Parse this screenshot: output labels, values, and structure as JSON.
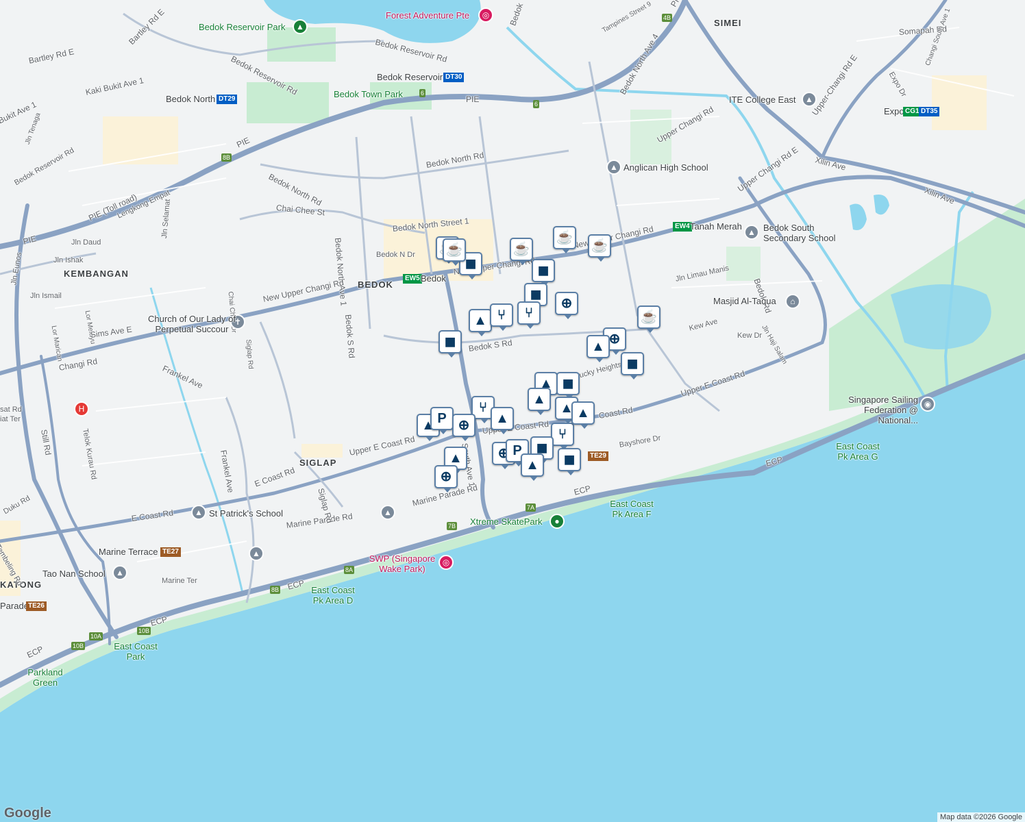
{
  "map": {
    "attribution": "Map data ©2026 Google",
    "logo": "Google",
    "colors": {
      "sea": "#8ed6ee",
      "park": "#c8ecd2",
      "road_major": "#8aa2c3",
      "land": "#f1f3f4",
      "pin_border": "#5b7fa6",
      "pin_icon": "#0b3b63"
    }
  },
  "areas": {
    "kembangan": "KEMBANGAN",
    "bedok": "BEDOK",
    "siglap": "SIGLAP",
    "simei": "SIMEI",
    "katong": "KATONG"
  },
  "roads": {
    "bartley": "Bartley Rd E",
    "bartley2": "Bartley Rd E",
    "kaki": "Kaki Bukit Ave 1",
    "bukit_ave": "Bukit Ave 1",
    "jln_tenaga": "Jln Tenaga",
    "bedok_res_rd_w": "Bedok Reservoir Rd",
    "bedok_res_rd": "Bedok Reservoir Rd",
    "bedok_res_rd2": "Bedok Reservoir Rd",
    "bedok_north_rd": "Bedok North Rd",
    "bedok_north_rd2": "Bedok North Rd",
    "chai_chee": "Chai Chee St",
    "lengkong": "Lengkong Empat",
    "jln_selamat": "Jln Selamat",
    "jln_daud": "Jln Daud",
    "jln_ishak": "Jln Ishak",
    "jln_eunos": "Jln Eunos",
    "jln_ismail": "Jln Ismail",
    "lor_marican": "Lor Marican",
    "lor_melayu": "Lor Melayu",
    "chai_chee_dr": "Chai Chee Dr",
    "siglap_rd": "Siglap Rd",
    "bedok_n_st1": "Bedok North Street 1",
    "bedok_n_dr": "Bedok N Dr",
    "bedok_n_ave1": "Bedok North Ave 1",
    "bedok_s_rd_v": "Bedok S Rd",
    "bedok_s_rd": "Bedok S Rd",
    "new_upper_changi_w": "New Upper Changi Rd",
    "new_upper_changi_e": "New Upper Changi Rd",
    "new_upper_changi_c": "New Upper Changi Rd",
    "sims_ave": "Sims Ave E",
    "changi_rd": "Changi Rd",
    "frankel": "Frankel Ave",
    "frankel2": "Frankel Ave",
    "upper_e_coast_w": "Upper E Coast Rd",
    "upper_e_coast_c": "Upper E Coast Rd",
    "upper_e_coast_e": "Upper E Coast Rd",
    "upper_e_coast_e2": "Coast Rd",
    "e_coast_rd": "E Coast Rd",
    "e_coast_rd2": "E Coast Rd",
    "marine_parade": "Marine Parade Rd",
    "marine_parade2": "Marine Parade Rd",
    "marine_terrace_rd": "Marine Ter",
    "siglap_rd2": "Siglap Rd",
    "bedok_south_ave1": "South Ave 1",
    "bayshore": "Bayshore Dr",
    "stills": "Still Rd",
    "telok": "Telok Kurau Rd",
    "duku": "Duku Rd",
    "tembeling": "Tembeling Rd",
    "bedok_rd": "Bedok Rd",
    "upper_changi_rd": "Upper Changi Rd",
    "upper_changi_e": "Upper Changi Rd E",
    "upper_changi_e2": "Upper-Changi Rd E",
    "xilin": "Xilin Ave",
    "xilin2": "Xilin Ave",
    "bedok_north_ave4": "Bedok North Ave 4",
    "tampines_st": "Tampines Street 9",
    "somapah": "Somapah Rd",
    "expo_dr": "Expo Dr",
    "changi_south_ave1": "Changi South Ave 1",
    "jln_limau": "Jln Limau Manis",
    "kew_ave": "Kew Ave",
    "kew_dr": "Kew Dr",
    "jln_haji": "Jln Haji Salam",
    "lucky": "Lucky Heights",
    "pie1": "PIE",
    "pie2": "PIE",
    "pie3": "PIE",
    "pie4": "PIE",
    "pie_toll": "PIE (Toll road)",
    "ecp1": "ECP",
    "ecp2": "ECP",
    "ecp3": "ECP",
    "ecp4": "ECP",
    "ecp5": "ECP",
    "jln_sat": "sat Rd",
    "jln_iat": "iat Ter",
    "bedok_upper": "Bedok"
  },
  "places": {
    "forest_adventure": "Forest Adventure Pte",
    "bedok_reservoir_park": "Bedok Reservoir Park",
    "bedok_town_park": "Bedok Town Park",
    "ite": "ITE College East",
    "anglican": "Anglican High School",
    "bedok_south_sec": "Bedok South Secondary School",
    "masjid": "Masjid Al-Taqua",
    "church": "Church of Our Lady of Perpetual Succour",
    "st_patricks": "St Patrick's School",
    "tao_nan": "Tao Nan School",
    "sailing": "Singapore Sailing Federation @ National...",
    "xtreme": "Xtreme SkatePark",
    "swp": "SWP (Singapore Wake Park)",
    "ecp_f": "East Coast Pk Area F",
    "ecp_g": "East Coast Pk Area G",
    "ecp_d": "East Coast Pk Area D",
    "east_coast_park": "East Coast Park",
    "parkland": "Parkland Green"
  },
  "stations": {
    "bedok_reservoir": {
      "name": "Bedok Reservoir",
      "code": "DT30"
    },
    "bedok_north": {
      "name": "Bedok North",
      "code": "DT29"
    },
    "bedok": {
      "name": "Bedok",
      "code": "EW5"
    },
    "tanah_merah": {
      "name": "Tanah Merah",
      "code": "EW4"
    },
    "expo": {
      "name": "Expo",
      "code1": "CG1",
      "code2": "DT35"
    },
    "marine_terrace": {
      "name": "Marine Terrace",
      "code": "TE27"
    },
    "marine_parade": {
      "name": "Parade",
      "code": "TE26"
    },
    "bayshore": {
      "name": "",
      "code": "TE29"
    }
  },
  "exits": [
    "8B",
    "6",
    "6",
    "4B",
    "7A",
    "7B",
    "8A",
    "8B",
    "10A",
    "10B",
    "10B"
  ],
  "pin_types": {
    "cafe": "coffee-cup-icon",
    "shop": "shopping-bag-icon",
    "school": "graduation-cap-icon",
    "food": "fork-knife-icon",
    "cart": "shopping-cart-icon",
    "parking": "parking-icon"
  },
  "pins": [
    {
      "type": "cafe"
    },
    {
      "type": "cafe"
    },
    {
      "type": "shop"
    },
    {
      "type": "cafe"
    },
    {
      "type": "cafe"
    },
    {
      "type": "cafe"
    },
    {
      "type": "shop"
    },
    {
      "type": "shop"
    },
    {
      "type": "cart"
    },
    {
      "type": "school"
    },
    {
      "type": "food"
    },
    {
      "type": "food"
    },
    {
      "type": "shop"
    },
    {
      "type": "cafe"
    },
    {
      "type": "cart"
    },
    {
      "type": "school"
    },
    {
      "type": "shop"
    },
    {
      "type": "school"
    },
    {
      "type": "shop"
    },
    {
      "type": "school"
    },
    {
      "type": "food"
    },
    {
      "type": "school"
    },
    {
      "type": "school"
    },
    {
      "type": "school"
    },
    {
      "type": "parking"
    },
    {
      "type": "cart"
    },
    {
      "type": "school"
    },
    {
      "type": "food"
    },
    {
      "type": "shop"
    },
    {
      "type": "cart"
    },
    {
      "type": "parking"
    },
    {
      "type": "shop"
    },
    {
      "type": "school"
    },
    {
      "type": "school"
    },
    {
      "type": "cart"
    }
  ]
}
